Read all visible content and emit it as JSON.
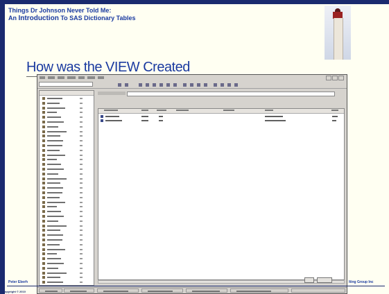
{
  "header": {
    "line1": "Things Dr Johnson Never Told Me:",
    "line2_prefix": "An ",
    "line2_big": "Introduction",
    "line2_suffix": " To SAS Dictionary Tables"
  },
  "slide_title": "How was the VIEW Created",
  "footer": {
    "left": "Peter Eberh",
    "right": "lting Group Inc",
    "copyright": "Copyright © 2010"
  },
  "screenshot": {
    "library_count": 40,
    "list_rows": 2
  },
  "colors": {
    "brand_blue": "#1a3aa0",
    "bar_navy": "#1a2a6e",
    "slide_bg": "#fffff2",
    "window_gray": "#d6d3ce"
  }
}
